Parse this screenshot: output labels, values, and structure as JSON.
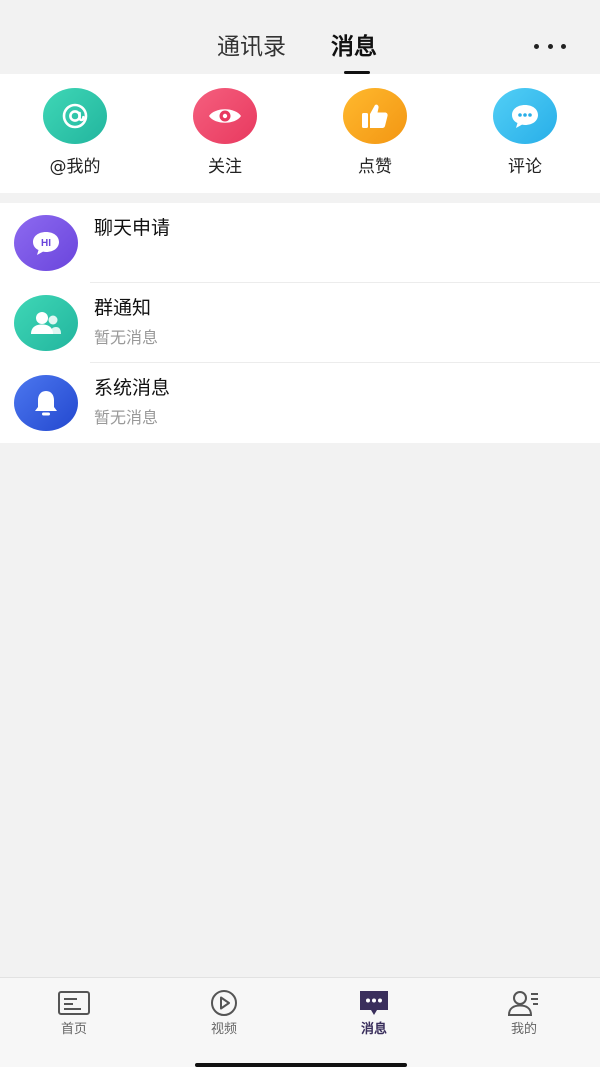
{
  "header": {
    "tabs": [
      {
        "label": "通讯录"
      },
      {
        "label": "消息"
      }
    ],
    "active_tab": "消息",
    "more_icon": "more-dots-icon"
  },
  "quick_actions": [
    {
      "label": "@我的",
      "icon": "at-icon",
      "color": "#2ec3a6"
    },
    {
      "label": "关注",
      "icon": "eye-icon",
      "color": "#ef4a6d"
    },
    {
      "label": "点赞",
      "icon": "thumbs-up-icon",
      "color": "#f7a21b"
    },
    {
      "label": "评论",
      "icon": "chat-bubble-icon",
      "color": "#38bdf0"
    }
  ],
  "messages": [
    {
      "title": "聊天申请",
      "subtitle": "",
      "icon": "hi-bubble-icon",
      "color": "#7b57e6"
    },
    {
      "title": "群通知",
      "subtitle": "暂无消息",
      "icon": "group-icon",
      "color": "#2ec3a6"
    },
    {
      "title": "系统消息",
      "subtitle": "暂无消息",
      "icon": "bell-icon",
      "color": "#2f5cdc"
    }
  ],
  "bottom_nav": [
    {
      "label": "首页",
      "icon": "home-card-icon"
    },
    {
      "label": "视频",
      "icon": "play-circle-icon"
    },
    {
      "label": "消息",
      "icon": "message-dots-icon",
      "active": true
    },
    {
      "label": "我的",
      "icon": "profile-icon"
    }
  ],
  "colors": {
    "background": "#f2f2f2",
    "nav_active": "#3a2f5c"
  }
}
